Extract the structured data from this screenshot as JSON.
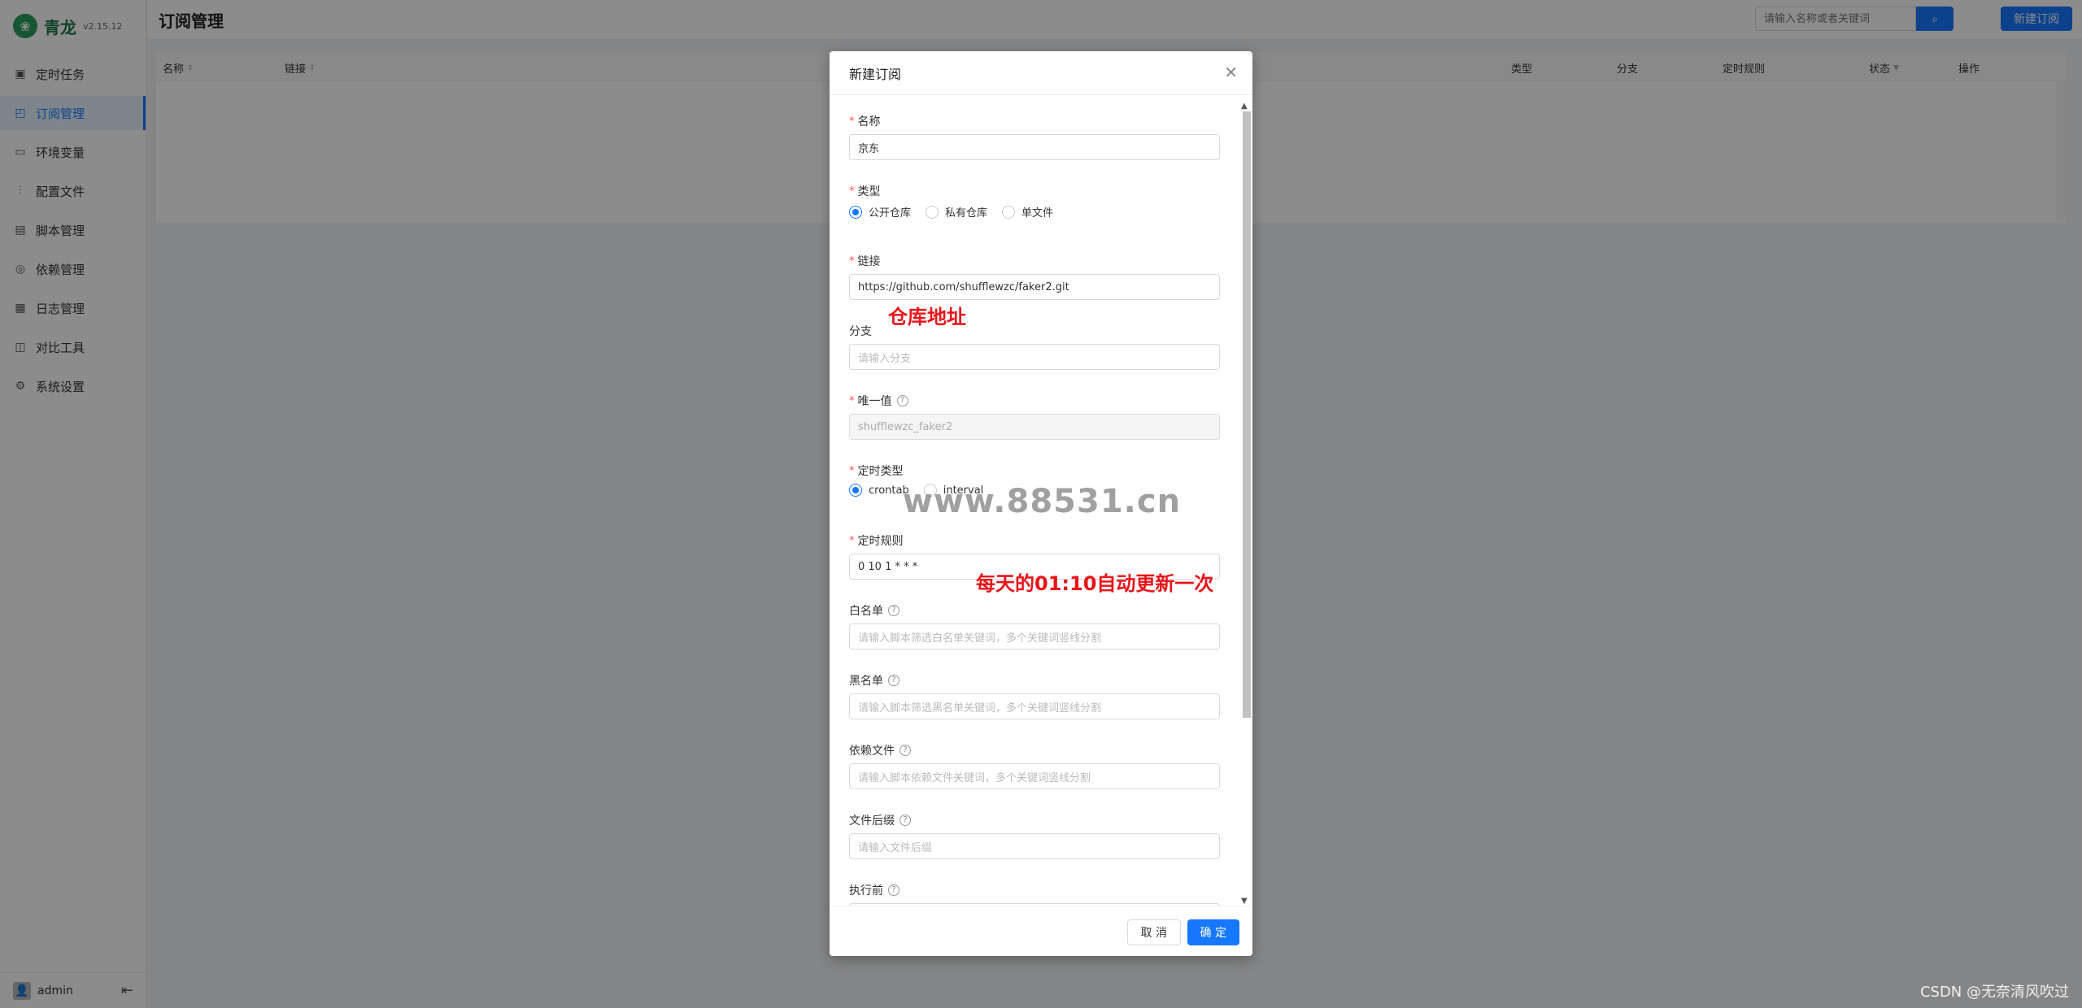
{
  "app": {
    "name": "青龙",
    "version": "v2.15.12"
  },
  "sidebar": {
    "items": [
      {
        "label": "定时任务",
        "icon": "clock-icon"
      },
      {
        "label": "订阅管理",
        "icon": "subscription-icon"
      },
      {
        "label": "环境变量",
        "icon": "monitor-icon"
      },
      {
        "label": "配置文件",
        "icon": "sliders-icon"
      },
      {
        "label": "脚本管理",
        "icon": "script-icon"
      },
      {
        "label": "依赖管理",
        "icon": "dependency-icon"
      },
      {
        "label": "日志管理",
        "icon": "log-icon"
      },
      {
        "label": "对比工具",
        "icon": "diff-icon"
      },
      {
        "label": "系统设置",
        "icon": "gear-icon"
      }
    ],
    "active_index": 1,
    "user": "admin"
  },
  "header": {
    "title": "订阅管理",
    "search_placeholder": "请输入名称或者关键词",
    "new_button": "新建订阅"
  },
  "table": {
    "columns": [
      "名称",
      "链接",
      "类型",
      "分支",
      "定时规则",
      "状态",
      "操作"
    ]
  },
  "modal": {
    "title": "新建订阅",
    "fields": {
      "name": {
        "label": "名称",
        "value": "京东"
      },
      "type": {
        "label": "类型",
        "options": [
          "公开仓库",
          "私有仓库",
          "单文件"
        ],
        "selected": "公开仓库"
      },
      "url": {
        "label": "链接",
        "value": "https://github.com/shufflewzc/faker2.git"
      },
      "branch": {
        "label": "分支",
        "placeholder": "请输入分支"
      },
      "alias": {
        "label": "唯一值",
        "value": "shufflewzc_faker2"
      },
      "schedule_type": {
        "label": "定时类型",
        "options": [
          "crontab",
          "interval"
        ],
        "selected": "crontab"
      },
      "schedule": {
        "label": "定时规则",
        "value": "0 10 1 * * *"
      },
      "whitelist": {
        "label": "白名单",
        "placeholder": "请输入脚本筛选白名单关键词，多个关键词竖线分割"
      },
      "blacklist": {
        "label": "黑名单",
        "placeholder": "请输入脚本筛选黑名单关键词，多个关键词竖线分割"
      },
      "dependence": {
        "label": "依赖文件",
        "placeholder": "请输入脚本依赖文件关键词，多个关键词竖线分割"
      },
      "extensions": {
        "label": "文件后缀",
        "placeholder": "请输入文件后缀"
      },
      "sub_before": {
        "label": "执行前"
      }
    },
    "cancel": "取 消",
    "ok": "确 定"
  },
  "annotations": {
    "repo_note": "仓库地址",
    "schedule_note": "每天的01:10自动更新一次",
    "watermark": "www.88531.cn",
    "credit": "CSDN @无奈清风吹过"
  }
}
